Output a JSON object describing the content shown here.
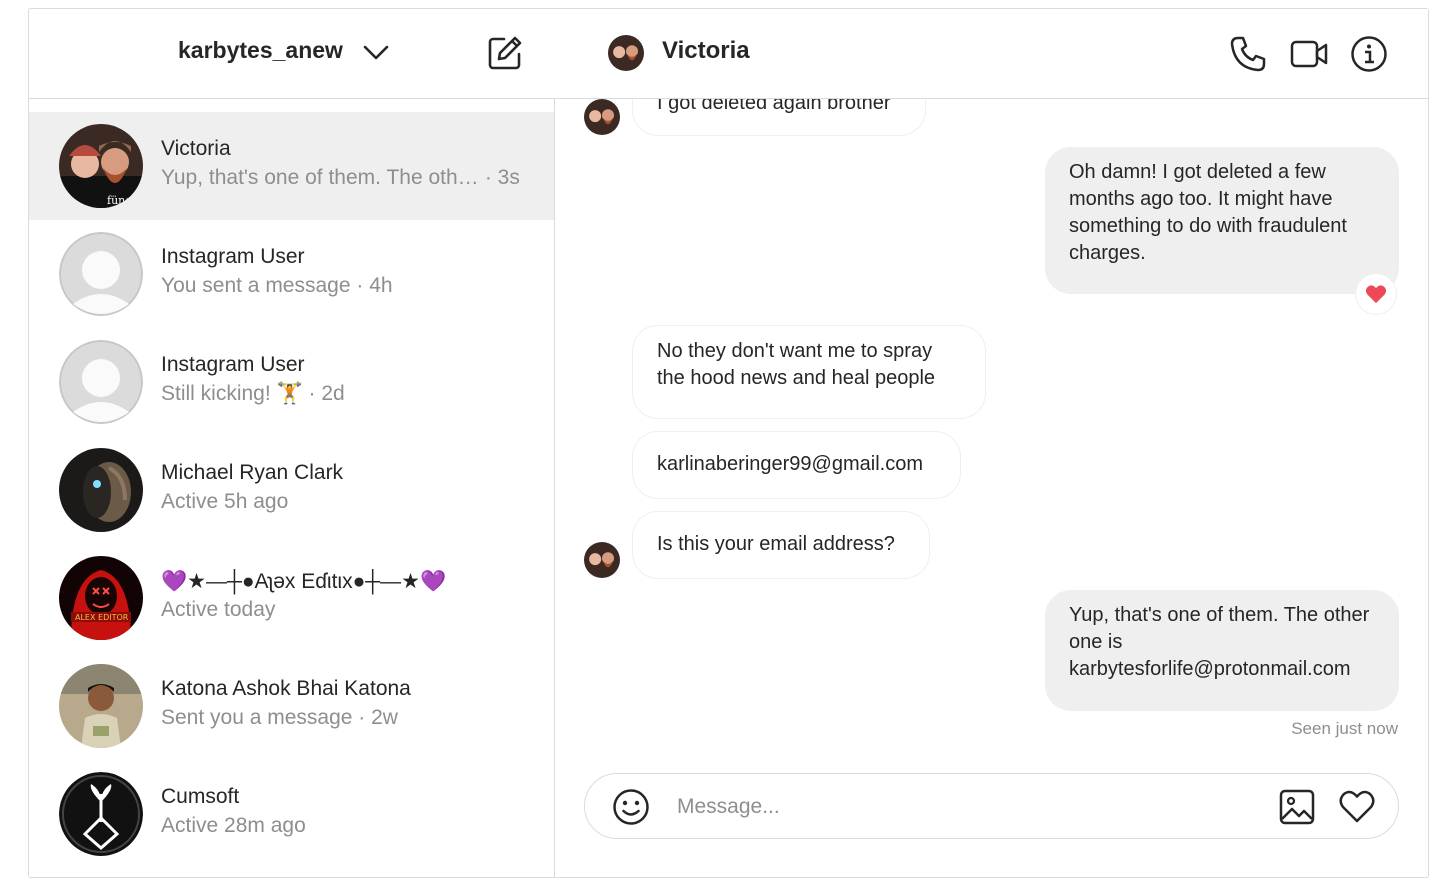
{
  "account": {
    "username": "karbytes_anew"
  },
  "threads": [
    {
      "name": "Victoria",
      "snippet": "Yup, that's one of them. The other one is karbytesforlife@protonmail.com",
      "time": "· 3s",
      "active": true
    },
    {
      "name": "Instagram User",
      "snippet": "You sent a message",
      "time": "· 4h"
    },
    {
      "name": "Instagram User",
      "snippet": "Still kicking! 🏋",
      "time": "· 2d"
    },
    {
      "name": "Michael Ryan Clark",
      "snippet": "Active 5h ago",
      "time": ""
    },
    {
      "name": "💜★—┼●Aʅəx Eɗιtιx●┼—★💜",
      "snippet": "Active today",
      "time": ""
    },
    {
      "name": "Katona Ashok Bhai Katona",
      "snippet": "Sent you a message",
      "time": "· 2w"
    },
    {
      "name": "Cumsoft",
      "snippet": "Active 28m ago",
      "time": ""
    }
  ],
  "conversation": {
    "title": "Victoria",
    "messages": [
      {
        "from": "them",
        "text": "I got deleted again brother"
      },
      {
        "from": "me",
        "text": "Oh damn! I got deleted a few months ago too. It might have something to do with fraudulent charges.",
        "reaction": "heart"
      },
      {
        "from": "them",
        "text": "No they don't want me to spray the hood news and heal people"
      },
      {
        "from": "them",
        "text": "karlinaberinger99@gmail.com"
      },
      {
        "from": "them",
        "text": "Is this your email address?"
      },
      {
        "from": "me",
        "text": "Yup, that's one of them. The other one is karbytesforlife@protonmail.com"
      }
    ],
    "seen": "Seen just now"
  },
  "composer": {
    "placeholder": "Message..."
  },
  "colors": {
    "heart": "#ed4956",
    "border": "#dbdbdb",
    "bubble_out": "#efefef",
    "muted": "#8e8e8e"
  },
  "icons": [
    "chevron-down-icon",
    "compose-icon",
    "phone-icon",
    "video-icon",
    "info-icon",
    "emoji-icon",
    "image-icon",
    "heart-icon"
  ]
}
